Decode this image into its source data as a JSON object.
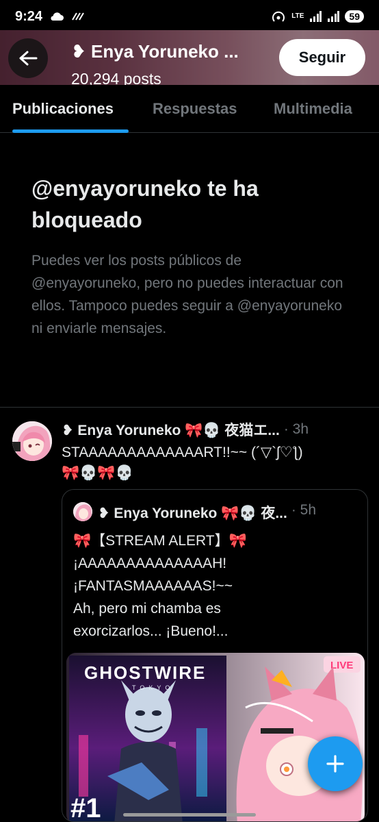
{
  "status_bar": {
    "time": "9:24",
    "network": "LTE",
    "battery": "59"
  },
  "header": {
    "title": "❥ Enya Yoruneko ...",
    "posts_count": "20,294 posts",
    "follow_label": "Seguir"
  },
  "tabs": [
    {
      "label": "Publicaciones",
      "active": true
    },
    {
      "label": "Respuestas",
      "active": false
    },
    {
      "label": "Multimedia",
      "active": false
    }
  ],
  "blocked": {
    "title": "@enyayoruneko te ha bloqueado",
    "description": "Puedes ver los posts públicos de @enyayoruneko, pero no puedes interactuar con ellos. Tampoco puedes seguir a @enyayoruneko ni enviarle mensajes."
  },
  "post": {
    "author": "❥ Enya Yoruneko 🎀💀 夜猫エ...",
    "time": "· 3h",
    "text_line1": "STAAAAAAAAAAAAART!!~~ (´▽`ʃ♡ƪ)",
    "text_line2": "🎀💀🎀💀",
    "quote": {
      "author": "❥ Enya Yoruneko 🎀💀 夜...",
      "time": "· 5h",
      "lines": [
        "🎀【STREAM ALERT】🎀",
        "¡AAAAAAAAAAAAAAH!",
        "¡FANTASMAAAAAAS!~~",
        "Ah, pero mi chamba es",
        "exorcizarlos... ¡Bueno!..."
      ],
      "media": {
        "game_title": "GHOSTWIRE",
        "game_sub": "TOKYO",
        "badge": "LIVE",
        "number": "#1"
      }
    }
  },
  "colors": {
    "accent": "#1d9bf0",
    "background": "#000000",
    "muted": "#71767b",
    "border": "#2f3336"
  },
  "icons": {
    "back": "arrow-left-icon",
    "compose": "plus-icon"
  }
}
